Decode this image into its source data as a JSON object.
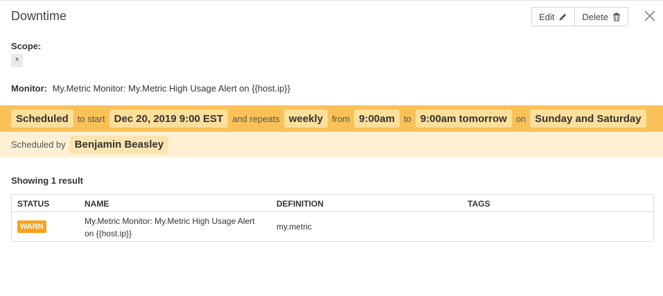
{
  "header": {
    "title": "Downtime",
    "edit_label": "Edit",
    "delete_label": "Delete"
  },
  "scope": {
    "label": "Scope:",
    "value": "*"
  },
  "monitor": {
    "label": "Monitor:",
    "value": "My.Metric Monitor: My.Metric High Usage Alert on {{host.ip}}"
  },
  "schedule": {
    "status": "Scheduled",
    "w_to_start": "to start",
    "start": "Dec 20, 2019 9:00 EST",
    "w_repeats": "and repeats",
    "frequency": "weekly",
    "w_from": "from",
    "from_time": "9:00am",
    "w_to": "to",
    "to_time": "9:00am tomorrow",
    "w_on": "on",
    "days": "Sunday and Saturday",
    "scheduled_by_label": "Scheduled by",
    "scheduled_by": "Benjamin Beasley",
    "colors": {
      "bar": "#f9c158",
      "bar_light": "#fdf0d4"
    }
  },
  "results": {
    "summary": "Showing 1 result",
    "columns": [
      "STATUS",
      "NAME",
      "DEFINITION",
      "TAGS"
    ],
    "rows": [
      {
        "status": "WARN",
        "status_color": "#f9a11b",
        "name": "My.Metric Monitor: My.Metric High Usage Alert on {{host.ip}}",
        "definition": "my.metric",
        "tags": ""
      }
    ]
  },
  "icons": {
    "edit": "pencil-icon",
    "delete": "trash-icon",
    "close": "close-icon"
  }
}
